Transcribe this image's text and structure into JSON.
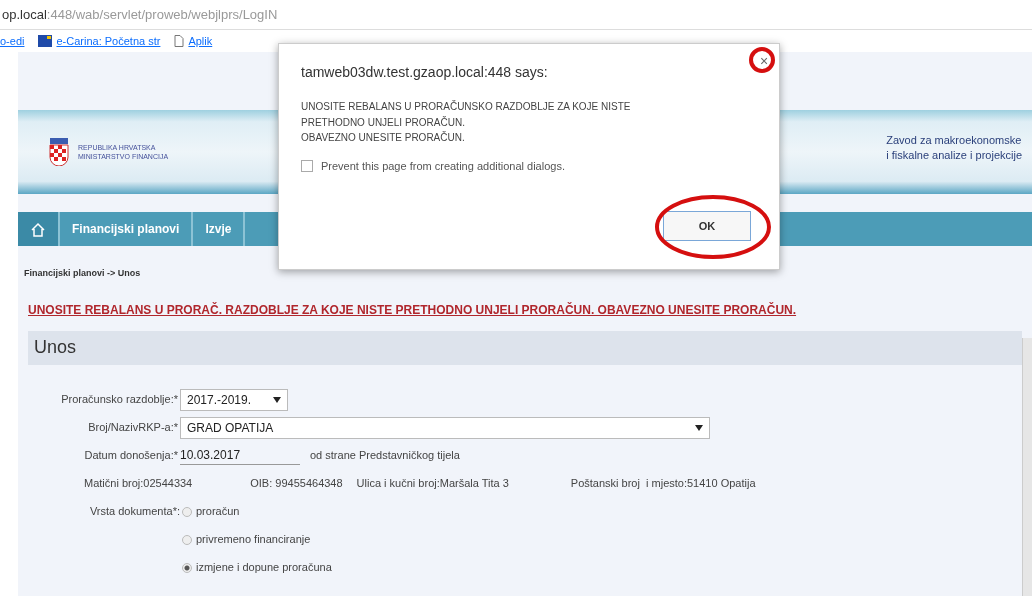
{
  "address_bar": {
    "host": "op.local",
    "path": ":448/wab/servlet/proweb/webjlprs/LogIN"
  },
  "bookmarks": [
    {
      "label": "o-edi",
      "kind": "text"
    },
    {
      "label": "e-Carina: Početna str",
      "kind": "flag"
    },
    {
      "label": "Aplik",
      "kind": "page"
    }
  ],
  "header": {
    "logo_lines": [
      "REPUBLIKA HRVATSKA",
      "MINISTARSTVO FINANCIJA"
    ],
    "right_lines": [
      "Zavod za makroekonomske",
      "i fiskalne analize i projekcije"
    ]
  },
  "tabs": [
    {
      "kind": "home",
      "selected": true
    },
    {
      "kind": "text",
      "label": "Financijski planovi",
      "selected": false
    },
    {
      "kind": "text",
      "label": "Izvje",
      "selected": false
    }
  ],
  "breadcrumb": "Financijski planovi -> Unos",
  "warning": "UNOSITE REBALANS U PRORAČ. RAZDOBLJE ZA KOJE NISTE PRETHODNO UNJELI PRORAČUN. OBAVEZNO UNESITE PRORAČUN.",
  "section_title": "Unos",
  "form": {
    "period": {
      "label": "Proračunsko razdoblje:*",
      "value": "2017.-2019."
    },
    "rkp": {
      "label": "Broj/NazivRKP-a:*",
      "value": "GRAD OPATIJA"
    },
    "date": {
      "label": "Datum donošenja:*",
      "value": "10.03.2017",
      "note": "od strane Predstavničkog tijela"
    },
    "info": [
      "Matični broj:02544334",
      "OIB: 99455464348",
      "Ulica i kučni broj:Maršala Tita 3",
      "Poštanski broj  i mjesto:51410 Opatija"
    ],
    "doc_type": {
      "label": "Vrsta dokumenta*:",
      "options": [
        {
          "label": "proračun",
          "selected": false
        },
        {
          "label": "privremeno financiranje",
          "selected": false
        },
        {
          "label": "izmjene i dopune proračuna",
          "selected": true
        }
      ]
    }
  },
  "dialog": {
    "title": "tamweb03dw.test.gzaop.local:448 says:",
    "message_lines": [
      "UNOSITE REBALANS U PRORAČUNSKO RAZDOBLJE ZA KOJE NISTE",
      "PRETHODNO UNJELI PRORAČUN.",
      "OBAVEZNO UNESITE PRORAČUN."
    ],
    "checkbox": {
      "label": "Prevent this page from creating additional dialogs.",
      "checked": false
    },
    "ok_button": "OK",
    "close": "×"
  }
}
